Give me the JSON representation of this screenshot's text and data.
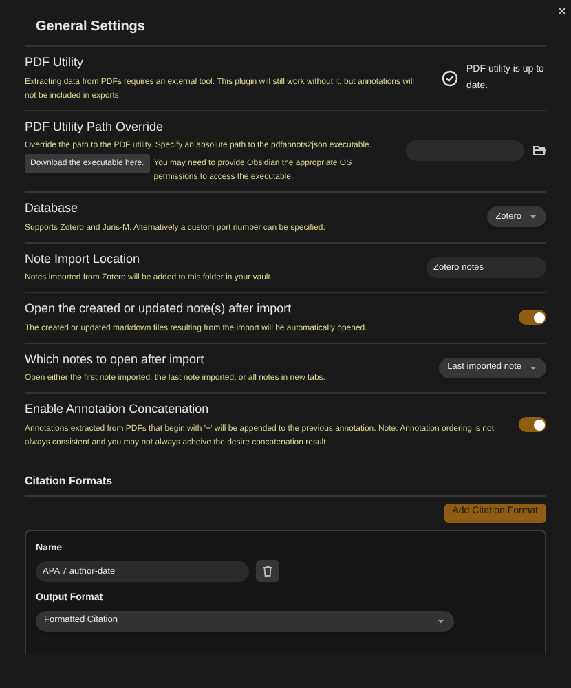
{
  "close_label": "×",
  "general": {
    "heading": "General Settings"
  },
  "settings": [
    {
      "kind": "status",
      "title": "PDF Utility",
      "description": "Extracting data from PDFs requires an external tool. This plugin will still work without it, but annotations will not be included in exports.",
      "status": "PDF utility is up to date."
    },
    {
      "kind": "path",
      "title": "PDF Utility Path Override",
      "description": "Override the path to the PDF utility. Specify an absolute path to the pdfannots2json executable.",
      "button": "Download the executable here.",
      "note": "You may need to provide Obsidian the appropriate OS permissions to access the executable."
    },
    {
      "kind": "dropdown",
      "title": "Database",
      "description": "Supports Zotero and Juris-M. Alternatively a custom port number can be specified.",
      "value": "Zotero"
    },
    {
      "kind": "text",
      "title": "Note Import Location",
      "description": "Notes imported from Zotero will be added to this folder in your vault",
      "value": "Zotero notes"
    },
    {
      "kind": "toggle",
      "title": "Open the created or updated note(s) after import",
      "description": "The created or updated markdown files resulting from the import will be automatically opened.",
      "on": true
    },
    {
      "kind": "dropdown",
      "title": "Which notes to open after import",
      "description": "Open either the first note imported, the last note imported, or all notes in new tabs.",
      "value": "Last imported note"
    },
    {
      "kind": "toggle",
      "title": "Enable Annotation Concatenation",
      "description": "Annotations extracted from PDFs that begin with '+' will be appended to the previous annotation. Note: Annotation ordering is not always consistent and you may not always acheive the desire concatenation result",
      "on": true
    }
  ],
  "citation_formats": {
    "heading": "Citation Formats",
    "add_button": "Add Citation Format",
    "card": {
      "name_label": "Name",
      "name_value": "APA 7 author-date",
      "output_label": "Output Format",
      "output_value": "Formatted Citation"
    }
  }
}
